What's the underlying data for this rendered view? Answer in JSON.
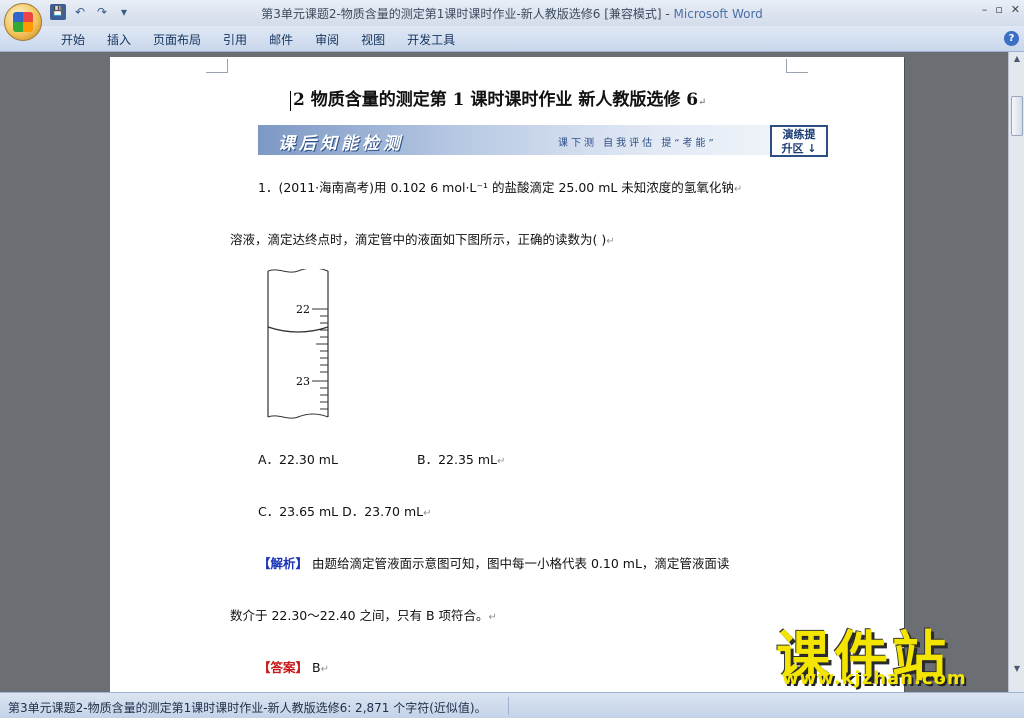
{
  "window": {
    "title": "第3单元课题2-物质含量的测定第1课时课时作业-新人教版选修6 [兼容模式] - ",
    "app_name": "Microsoft Word"
  },
  "qat": {
    "save": "💾",
    "undo": "↶",
    "redo": "↷",
    "more": "▾"
  },
  "window_controls": {
    "minimize": "–",
    "restore": "▫",
    "close": "✕"
  },
  "ribbon": {
    "tabs": [
      "开始",
      "插入",
      "页面布局",
      "引用",
      "邮件",
      "审阅",
      "视图",
      "开发工具"
    ],
    "help": "?"
  },
  "document": {
    "title": "2  物质含量的测定第 1 课时课时作业  新人教版选修 6",
    "banner": {
      "left": "课后知能检测",
      "middle": "课下测  自我评估  提“考能”",
      "box_line1": "演练提",
      "box_line2": "升区 ↓"
    },
    "q1_line1": "1．(2011·海南高考)用 0.102 6 mol·L⁻¹ 的盐酸滴定 25.00 mL 未知浓度的氢氧化钠",
    "q1_line2": "溶液，滴定达终点时，滴定管中的液面如下图所示，正确的读数为(     )",
    "burette_labels": [
      "22",
      "23"
    ],
    "option_a": "A．22.30 mL",
    "option_b": "B．22.35 mL",
    "option_cd": "C．23.65 mL   D．23.70 mL",
    "analysis_tag": "【解析】",
    "analysis_text": "  由题给滴定管液面示意图可知，图中每一小格代表 0.10 mL，滴定管液面读",
    "analysis_text2": "数介于 22.30～22.40 之间，只有 B 项符合。",
    "answer_tag": "【答案】",
    "answer_text": "  B"
  },
  "statusbar": {
    "text": "第3单元课题2-物质含量的测定第1课时课时作业-新人教版选修6: 2,871 个字符(近似值)。"
  },
  "watermark": {
    "main": "课件站",
    "url": "www.kjzhan.com"
  },
  "colors": {
    "accent_blue": "#1a35b8",
    "answer_red": "#c61a1a",
    "watermark": "#f4e500"
  }
}
